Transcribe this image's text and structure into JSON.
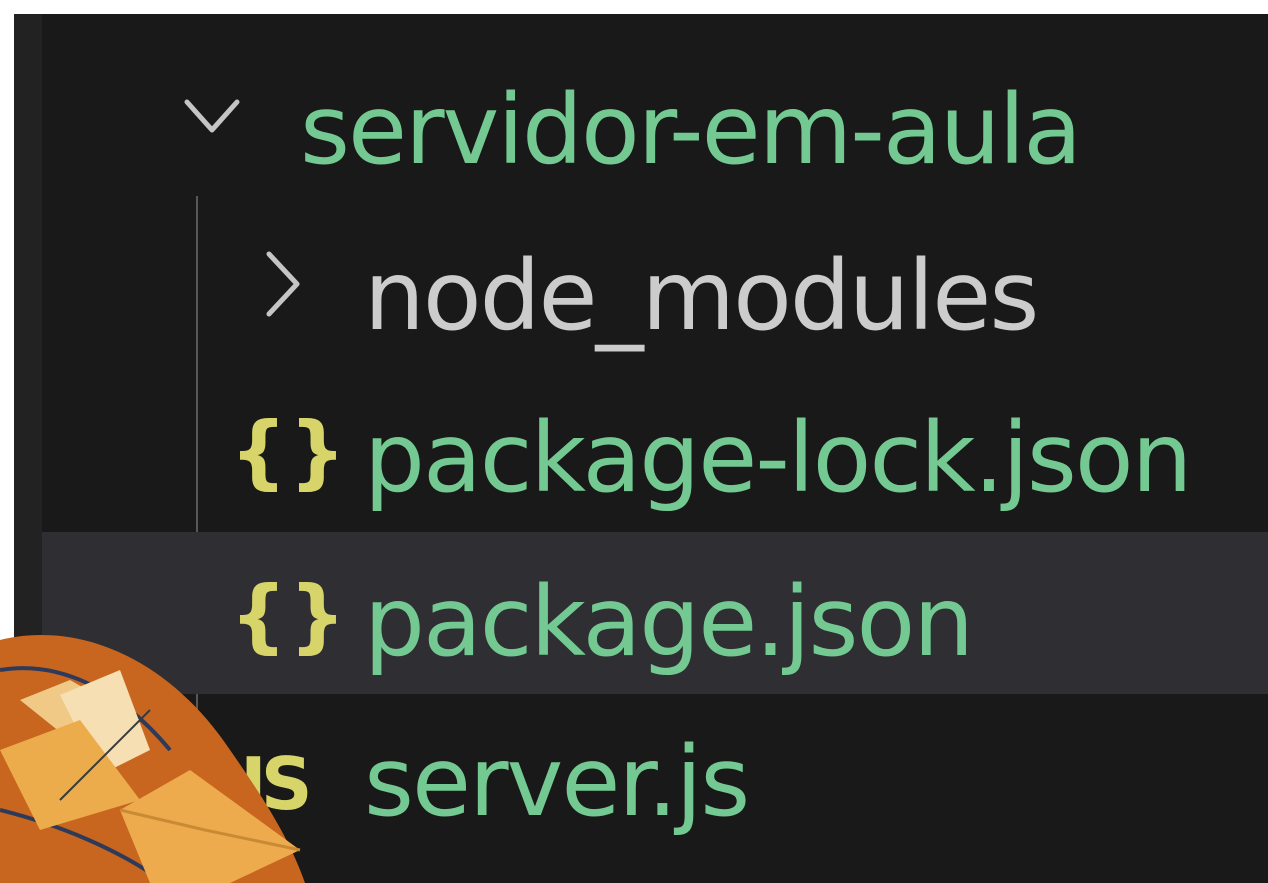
{
  "explorer": {
    "root": {
      "label": "servidor-em-aula",
      "expanded": true,
      "icon": "chevron-down-icon"
    },
    "items": [
      {
        "label": "node_modules",
        "type": "folder",
        "icon": "chevron-right-icon",
        "expanded": false
      },
      {
        "label": "package-lock.json",
        "type": "json",
        "icon_text": "{}"
      },
      {
        "label": "package.json",
        "type": "json",
        "icon_text": "{}",
        "selected": true
      },
      {
        "label": "server.js",
        "type": "js",
        "icon_text": "JS"
      }
    ]
  },
  "colors": {
    "background": "#191919",
    "selected_row": "#2e2e33",
    "modified_text": "#73c991",
    "folder_text": "#cccccc",
    "json_icon": "#d7d46a",
    "js_icon": "#d7d46a"
  }
}
